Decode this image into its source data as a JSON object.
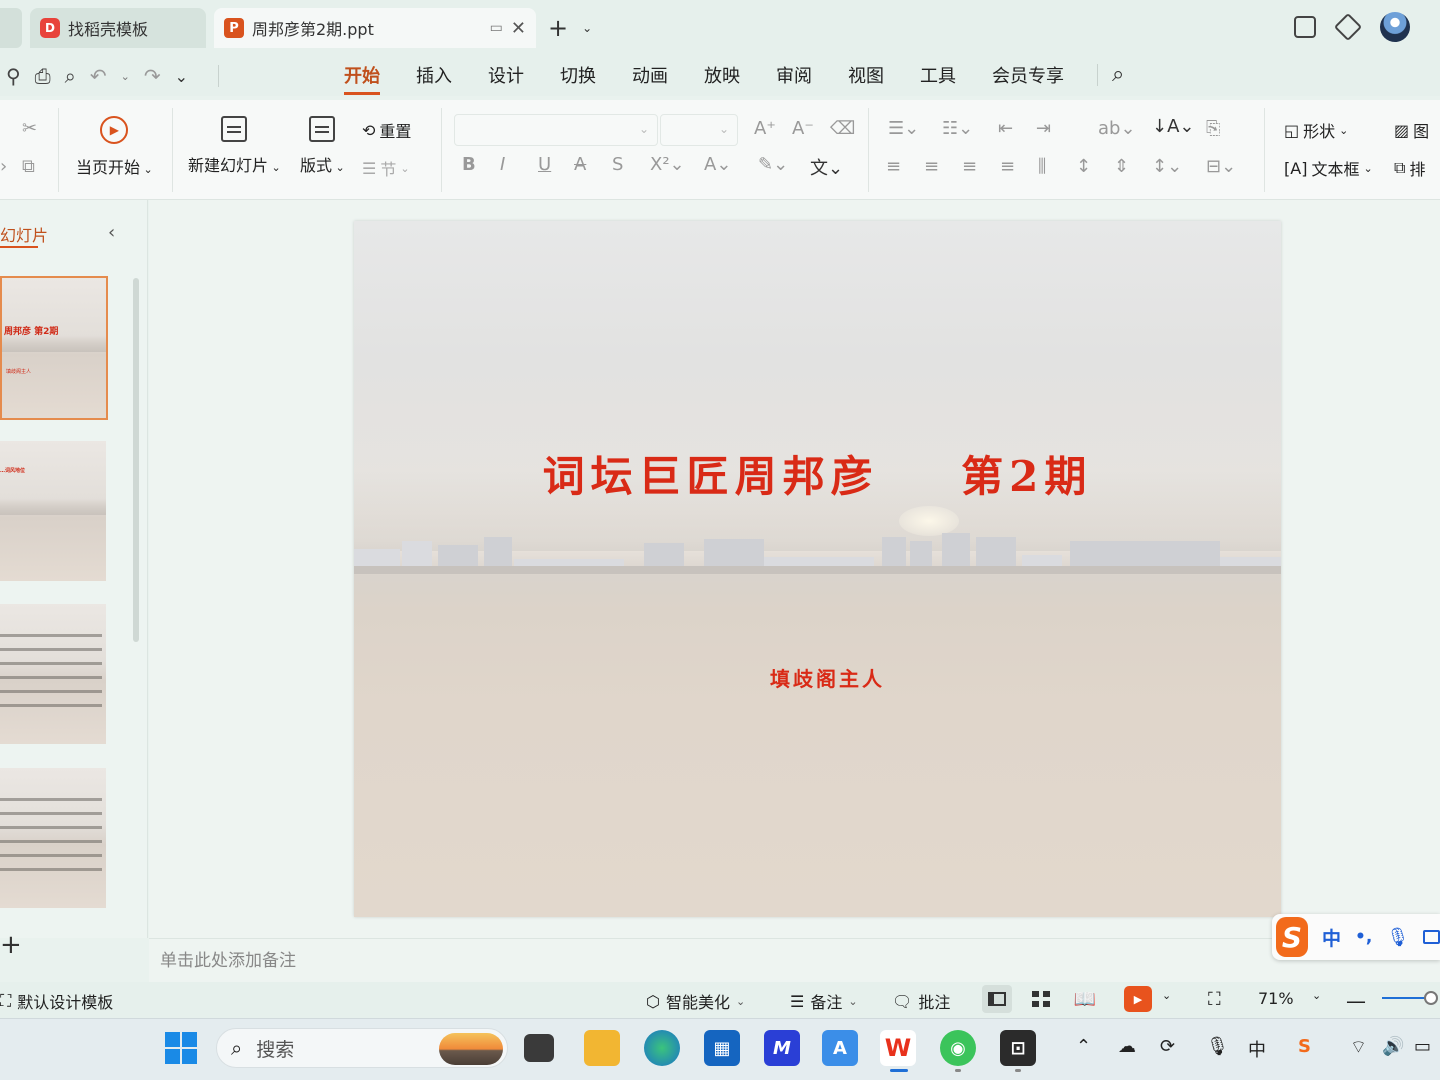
{
  "tabs": [
    {
      "label": "找稻壳模板",
      "icon": "docer-icon"
    },
    {
      "label": "周邦彦第2期.ppt",
      "icon": "ppt-icon"
    }
  ],
  "menu": {
    "items": [
      "开始",
      "插入",
      "设计",
      "切换",
      "动画",
      "放映",
      "审阅",
      "视图",
      "工具",
      "会员专享"
    ],
    "active": "开始"
  },
  "ribbon": {
    "play_from_current": "当页开始",
    "new_slide": "新建幻灯片",
    "layout": "版式",
    "reset": "重置",
    "section": "节",
    "shape": "形状",
    "picture": "图",
    "textbox": "文本框",
    "arrange": "排"
  },
  "left_panel": {
    "title": "幻灯片",
    "thumbnails": [
      {
        "title": "周邦彦   第2期",
        "subtitle": "填歧阁主人"
      },
      {
        "title": "…词风地位"
      },
      {
        "title": ""
      },
      {
        "title": ""
      }
    ]
  },
  "slide": {
    "title": "词坛巨匠周邦彦    第2期",
    "subtitle": "填歧阁主人"
  },
  "notes": {
    "placeholder": "单击此处添加备注"
  },
  "ime": {
    "mode": "中",
    "punct": "•,"
  },
  "statusbar": {
    "template": "默认设计模板",
    "beautify": "智能美化",
    "notes": "备注",
    "comment": "批注",
    "zoom": "71%"
  },
  "taskbar": {
    "search_placeholder": "搜索"
  },
  "colors": {
    "accent": "#d9531e",
    "slide_title": "#d92a16",
    "ime_blue": "#1f5fd6"
  }
}
